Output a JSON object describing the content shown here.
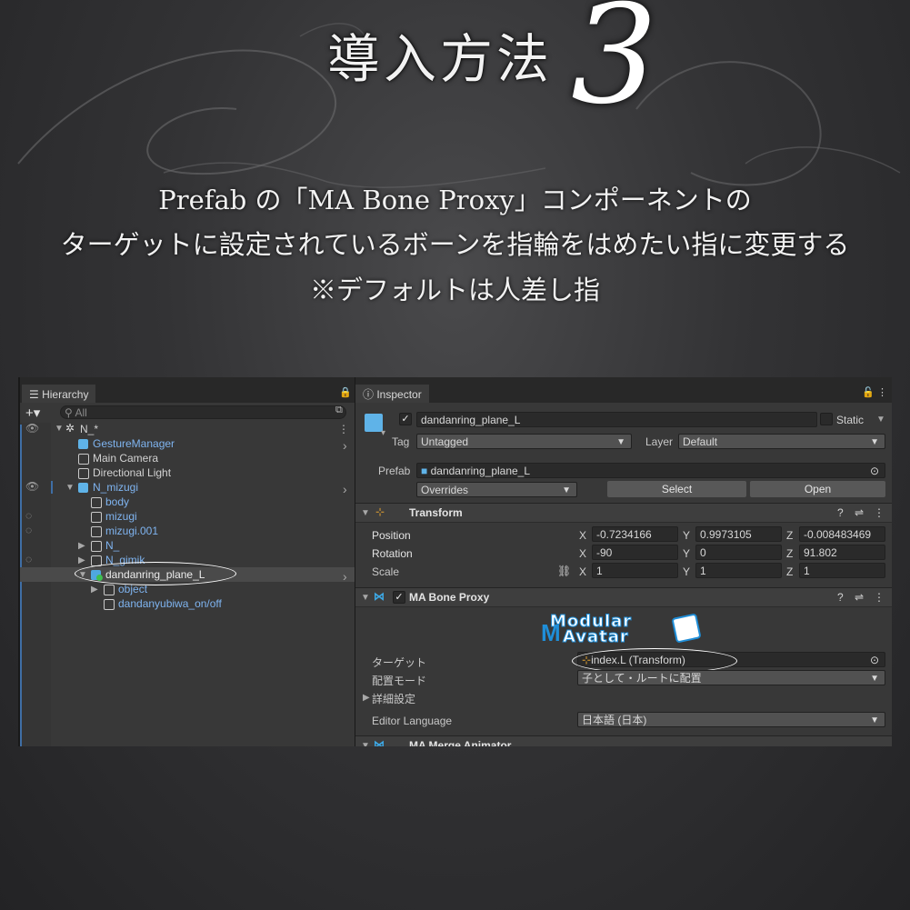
{
  "heading": {
    "title": "導入方法",
    "number": "3",
    "line1": "Prefab の「MA Bone Proxy」コンポーネントの",
    "line2": "ターゲットに設定されているボーンを指輪をはめたい指に変更する",
    "line3": "※デフォルトは人差し指"
  },
  "hierarchy": {
    "tab_label": "Hierarchy",
    "search_placeholder": "All",
    "scene": "N_*",
    "items": [
      {
        "label": "GestureManager"
      },
      {
        "label": "Main Camera"
      },
      {
        "label": "Directional Light"
      },
      {
        "label": "N_mizugi"
      },
      {
        "label": "body"
      },
      {
        "label": "mizugi"
      },
      {
        "label": "mizugi.001"
      },
      {
        "label": "N_"
      },
      {
        "label": "N_gimik"
      },
      {
        "label": "dandanring_plane_L"
      },
      {
        "label": "object"
      },
      {
        "label": "dandanyubiwa_on/off"
      }
    ]
  },
  "inspector": {
    "tab_label": "Inspector",
    "object_name": "dandanring_plane_L",
    "static_label": "Static",
    "tag_label": "Tag",
    "tag_value": "Untagged",
    "layer_label": "Layer",
    "layer_value": "Default",
    "prefab_label": "Prefab",
    "prefab_value": "dandanring_plane_L",
    "overrides_label": "Overrides",
    "select_label": "Select",
    "open_label": "Open",
    "transform": {
      "title": "Transform",
      "position_label": "Position",
      "rotation_label": "Rotation",
      "scale_label": "Scale",
      "position": {
        "x": "-0.7234166",
        "y": "0.9973105",
        "z": "-0.008483469"
      },
      "rotation": {
        "x": "-90",
        "y": "0",
        "z": "91.802"
      },
      "scale": {
        "x": "1",
        "y": "1",
        "z": "1"
      },
      "x_label": "X",
      "y_label": "Y",
      "z_label": "Z"
    },
    "bone_proxy": {
      "title": "MA Bone Proxy",
      "logo_line1": "Modular",
      "logo_line2": "Avatar",
      "target_label": "ターゲット",
      "target_value": "index.L (Transform)",
      "placement_label": "配置モード",
      "placement_value": "子として・ルートに配置",
      "details_label": "詳細設定",
      "language_label": "Editor Language",
      "language_value": "日本語 (日本)"
    },
    "next_component": "MA Merge Animator"
  }
}
